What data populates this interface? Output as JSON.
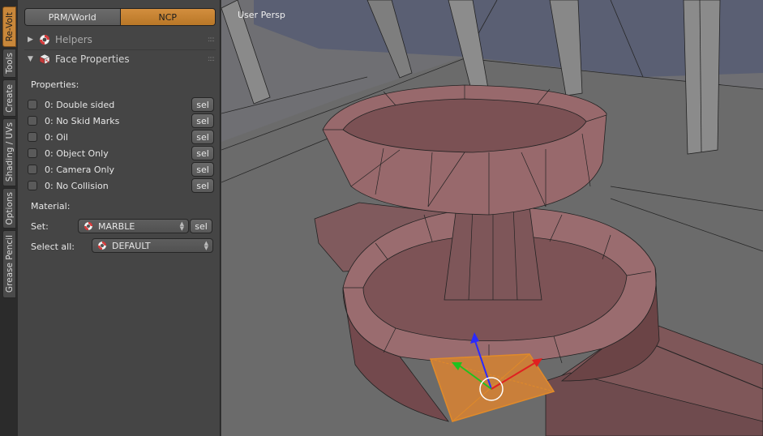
{
  "tabs": [
    {
      "label": "Re-Volt",
      "active": true
    },
    {
      "label": "Tools",
      "active": false
    },
    {
      "label": "Create",
      "active": false
    },
    {
      "label": "Shading / UVs",
      "active": false
    },
    {
      "label": "Options",
      "active": false
    },
    {
      "label": "Grease Pencil",
      "active": false
    }
  ],
  "mode": {
    "left": "PRM/World",
    "right": "NCP",
    "selected": "NCP"
  },
  "sections": {
    "helpers": {
      "title": "Helpers",
      "expanded": false,
      "icon": "lifebuoy-icon"
    },
    "face": {
      "title": "Face Properties",
      "expanded": true,
      "icon": "cube-checker-icon"
    }
  },
  "properties": {
    "heading": "Properties:",
    "items": [
      {
        "label": "0: Double sided",
        "checked": false,
        "button": "sel"
      },
      {
        "label": "0: No Skid Marks",
        "checked": false,
        "button": "sel"
      },
      {
        "label": "0: Oil",
        "checked": false,
        "button": "sel"
      },
      {
        "label": "0: Object Only",
        "checked": false,
        "button": "sel"
      },
      {
        "label": "0: Camera Only",
        "checked": false,
        "button": "sel"
      },
      {
        "label": "0: No Collision",
        "checked": false,
        "button": "sel"
      }
    ]
  },
  "material": {
    "heading": "Material:",
    "set_label": "Set:",
    "set_value": "MARBLE",
    "set_button": "sel",
    "select_all_label": "Select all:",
    "select_all_value": "DEFAULT"
  },
  "viewport": {
    "label": "User Persp",
    "colors": {
      "mesh": "#8a5f62",
      "selected_face": "#c97f3a",
      "background": "#6d6d6d"
    }
  }
}
